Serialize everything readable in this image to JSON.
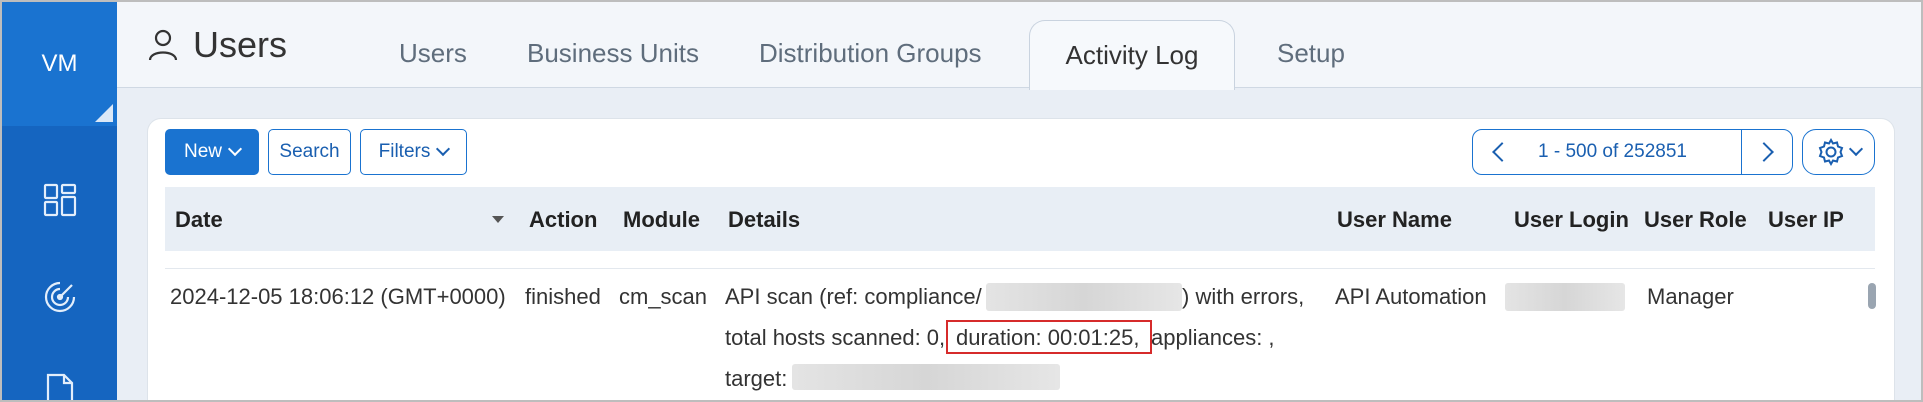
{
  "rail": {
    "logo": "VM",
    "icons": [
      "dashboard-icon",
      "scan-radar-icon",
      "document-icon"
    ]
  },
  "header": {
    "title": "Users",
    "tabs": [
      {
        "label": "Users",
        "active": false
      },
      {
        "label": "Business Units",
        "active": false
      },
      {
        "label": "Distribution Groups",
        "active": false
      },
      {
        "label": "Activity Log",
        "active": true
      },
      {
        "label": "Setup",
        "active": false
      }
    ]
  },
  "toolbar": {
    "new_label": "New",
    "search_label": "Search",
    "filters_label": "Filters",
    "pagination": "1 - 500 of 252851"
  },
  "table": {
    "columns": [
      "Date",
      "Action",
      "Module",
      "Details",
      "User Name",
      "User Login",
      "User Role",
      "User IP"
    ],
    "row": {
      "date": "2024-12-05 18:06:12 (GMT+0000)",
      "action": "finished",
      "module": "cm_scan",
      "details_line1_prefix": "API scan (ref: compliance/",
      "details_line1_suffix": ") with errors,",
      "details_line2_prefix": "total hosts scanned: 0,",
      "details_line2_highlight": "duration: 00:01:25,",
      "details_line2_suffix": "appliances: ,",
      "details_line3_prefix": "target:",
      "user_name": "API Automation",
      "user_role": "Manager"
    }
  },
  "colors": {
    "rail": "#1565c0",
    "accent": "#1a73d0",
    "highlight_border": "#d62b2b"
  }
}
